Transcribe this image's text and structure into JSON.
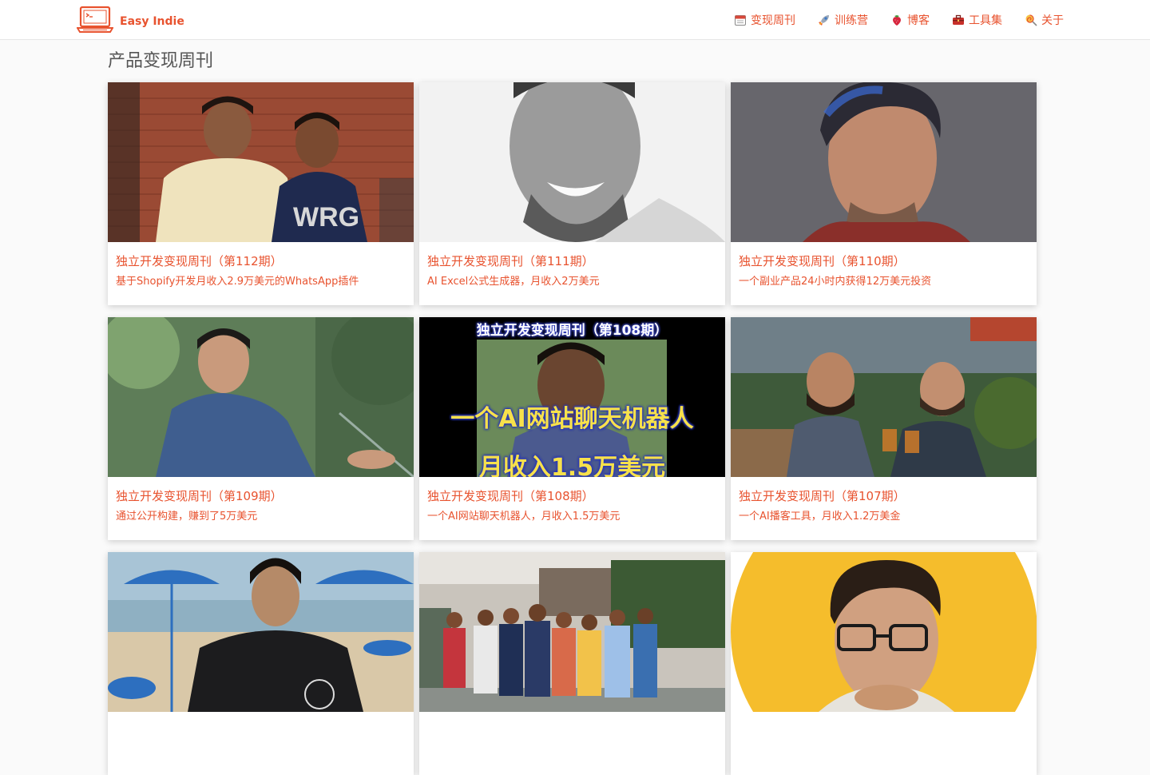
{
  "brand": {
    "name": "Easy Indie"
  },
  "nav": [
    {
      "label": "变现周刊",
      "icon": "calendar-icon"
    },
    {
      "label": "训练营",
      "icon": "rocket-icon"
    },
    {
      "label": "博客",
      "icon": "strawberry-icon"
    },
    {
      "label": "工具集",
      "icon": "toolbox-icon"
    },
    {
      "label": "关于",
      "icon": "lollipop-icon"
    }
  ],
  "page": {
    "title": "产品变现周刊"
  },
  "colors": {
    "accent": "#e8532f"
  },
  "cards": [
    {
      "title": "独立开发变现周刊（第112期）",
      "desc": "基于Shopify开发月收入2.9万美元的WhatsApp插件"
    },
    {
      "title": "独立开发变现周刊（第111期）",
      "desc": "AI Excel公式生成器，月收入2万美元"
    },
    {
      "title": "独立开发变现周刊（第110期）",
      "desc": "一个副业产品24小时内获得12万美元投资"
    },
    {
      "title": "独立开发变现周刊（第109期）",
      "desc": "通过公开构建，赚到了5万美元"
    },
    {
      "title": "独立开发变现周刊（第108期）",
      "desc": "一个AI网站聊天机器人，月收入1.5万美元",
      "overlay": {
        "top": "独立开发变现周刊（第108期）",
        "line1": "一个AI网站聊天机器人",
        "line2": "月收入1.5万美元"
      }
    },
    {
      "title": "独立开发变现周刊（第107期）",
      "desc": "一个AI播客工具，月收入1.2万美金"
    },
    {
      "title": "",
      "desc": ""
    },
    {
      "title": "",
      "desc": ""
    },
    {
      "title": "",
      "desc": ""
    }
  ]
}
